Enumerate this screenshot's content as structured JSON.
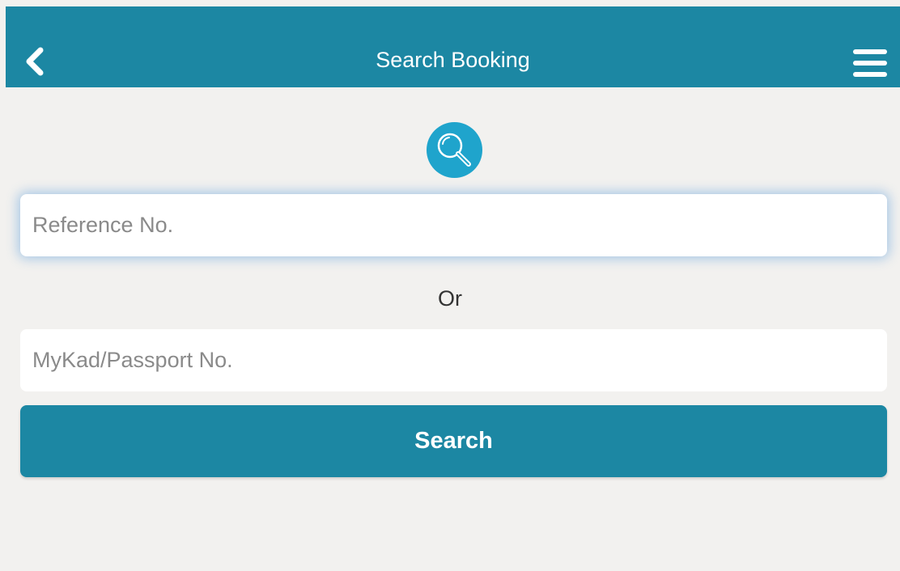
{
  "header": {
    "title": "Search Booking",
    "back_icon": "chevron-left-icon",
    "menu_icon": "hamburger-menu-icon",
    "background_color": "#1c87a3"
  },
  "search_icon": {
    "icon": "magnifier-icon",
    "color": "#1fa4cc"
  },
  "form": {
    "reference_placeholder": "Reference No.",
    "reference_value": "",
    "separator_text": "Or",
    "id_placeholder": "MyKad/Passport No.",
    "id_value": "",
    "submit_label": "Search"
  },
  "colors": {
    "page_background": "#f2f1ef",
    "accent": "#1c87a3",
    "input_focus_glow": "#5096dc"
  }
}
